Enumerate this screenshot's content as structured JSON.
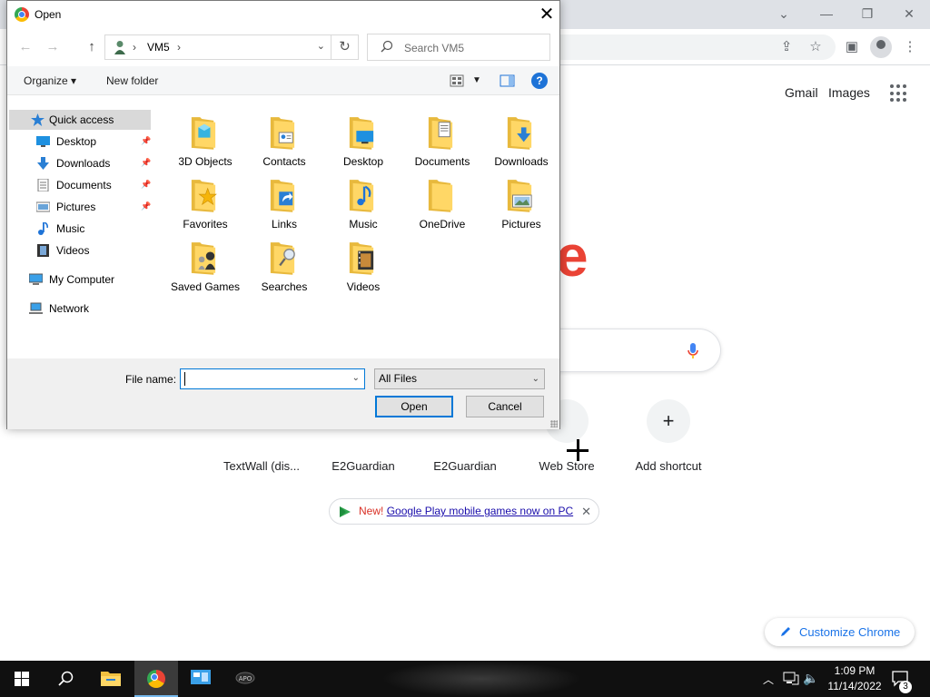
{
  "chrome": {
    "links": {
      "gmail": "Gmail",
      "images": "Images"
    },
    "logo_fragment": "e",
    "shortcuts": [
      {
        "label": "TextWall (dis..."
      },
      {
        "label": "E2Guardian"
      },
      {
        "label": "E2Guardian"
      },
      {
        "label": "Web Store"
      },
      {
        "label": "Add shortcut"
      }
    ],
    "promo": {
      "new": "New!",
      "link": "Google Play mobile games now on PC"
    },
    "customize_label": "Customize Chrome",
    "accent_color": "#1a73e8"
  },
  "dialog": {
    "title": "Open",
    "address": {
      "location": "VM5"
    },
    "search_placeholder": "Search VM5",
    "toolbar": {
      "organize": "Organize ▾",
      "new_folder": "New folder",
      "help": "?"
    },
    "nav": [
      {
        "label": "Quick access",
        "icon": "star-icon",
        "selected": true
      },
      {
        "label": "Desktop",
        "icon": "desktop-icon",
        "pinned": true
      },
      {
        "label": "Downloads",
        "icon": "download-icon",
        "pinned": true
      },
      {
        "label": "Documents",
        "icon": "document-icon",
        "pinned": true
      },
      {
        "label": "Pictures",
        "icon": "picture-icon",
        "pinned": true
      },
      {
        "label": "Music",
        "icon": "music-icon"
      },
      {
        "label": "Videos",
        "icon": "video-icon"
      },
      {
        "label": "My Computer",
        "icon": "computer-icon"
      },
      {
        "label": "Network",
        "icon": "network-icon"
      }
    ],
    "files": [
      {
        "name": "3D Objects",
        "overlay": "cube"
      },
      {
        "name": "Contacts",
        "overlay": "card"
      },
      {
        "name": "Desktop",
        "overlay": "screen"
      },
      {
        "name": "Documents",
        "overlay": "doc"
      },
      {
        "name": "Downloads",
        "overlay": "arrow"
      },
      {
        "name": "Favorites",
        "overlay": "star"
      },
      {
        "name": "Links",
        "overlay": "link"
      },
      {
        "name": "Music",
        "overlay": "note"
      },
      {
        "name": "OneDrive",
        "overlay": "none"
      },
      {
        "name": "Pictures",
        "overlay": "photo"
      },
      {
        "name": "Saved Games",
        "overlay": "chess"
      },
      {
        "name": "Searches",
        "overlay": "magnifier"
      },
      {
        "name": "Videos",
        "overlay": "film"
      }
    ],
    "file_name_label": "File name:",
    "file_name_value": "",
    "filter_value": "All Files",
    "open_label": "Open",
    "cancel_label": "Cancel"
  },
  "taskbar": {
    "time": "1:09 PM",
    "date": "11/14/2022",
    "notifications": "3"
  }
}
